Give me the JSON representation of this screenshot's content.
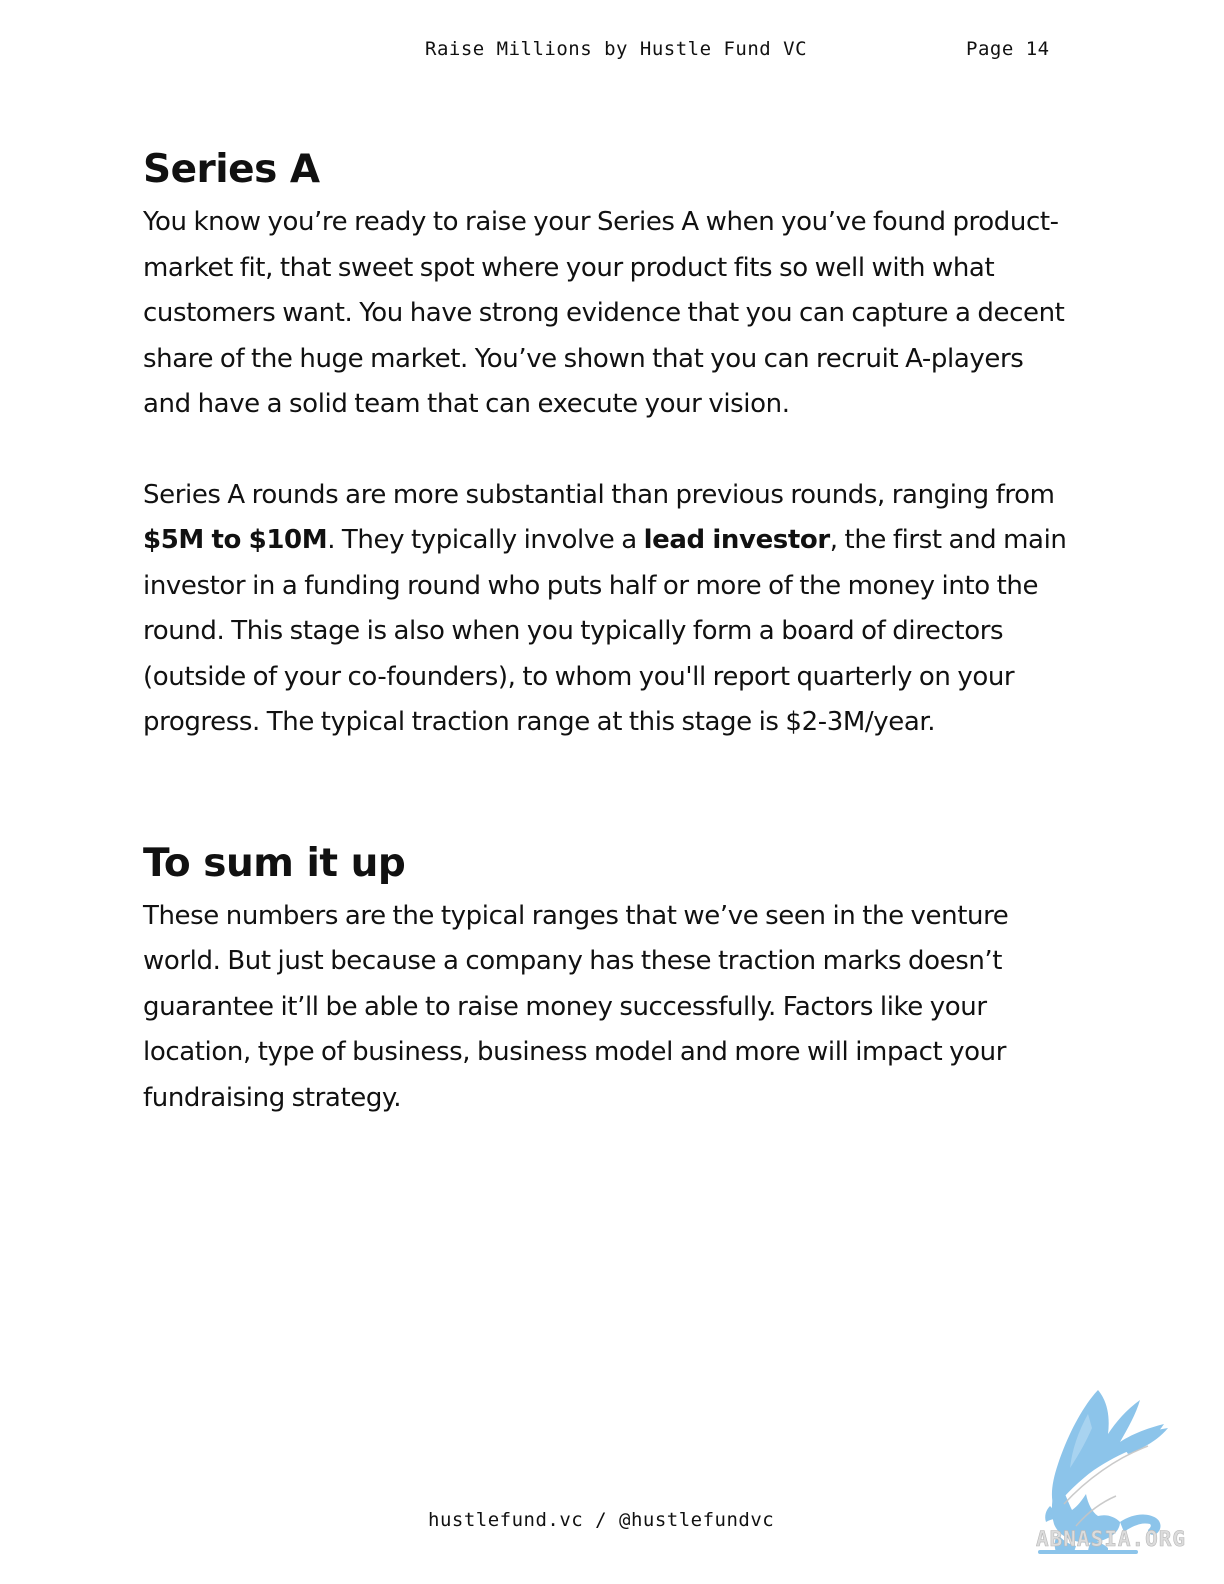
{
  "header": {
    "title": "Raise Millions by Hustle Fund VC",
    "page_label": "Page 14"
  },
  "series_a": {
    "heading": "Series A",
    "p1": "You know you’re ready to raise your Series A when you’ve found product-market fit, that sweet spot where your product fits so well with what customers want. You have strong evidence that you can capture a decent share of the huge market. You’ve shown that you can recruit A-players and have a solid team that can execute your vision.",
    "p2_a": "Series A rounds are more substantial than previous rounds, ranging from ",
    "p2_bold1": "$5M to $10M",
    "p2_b": ". They typically involve a ",
    "p2_bold2": "lead investor",
    "p2_c": ", the first and main investor in a funding round who puts half or more of the money into the round. This stage is also when you typically form a board of directors (outside of your co-founders), to whom you'll report quarterly on your progress. The typical traction range at this stage is $2-3M/year."
  },
  "sum_up": {
    "heading": "To sum it up",
    "p1": "These numbers are the typical ranges that we’ve seen in the venture world. But just because a company has these traction marks doesn’t guarantee it’ll be able to raise money successfully. Factors like your location, type of business, business model and more will impact your fundraising strategy."
  },
  "footer": {
    "text": "hustlefund.vc / @hustlefundvc"
  },
  "watermark": {
    "text": "ABNASIA.ORG",
    "icon": "griffin-logo-icon",
    "color": "#8cc4ea"
  }
}
